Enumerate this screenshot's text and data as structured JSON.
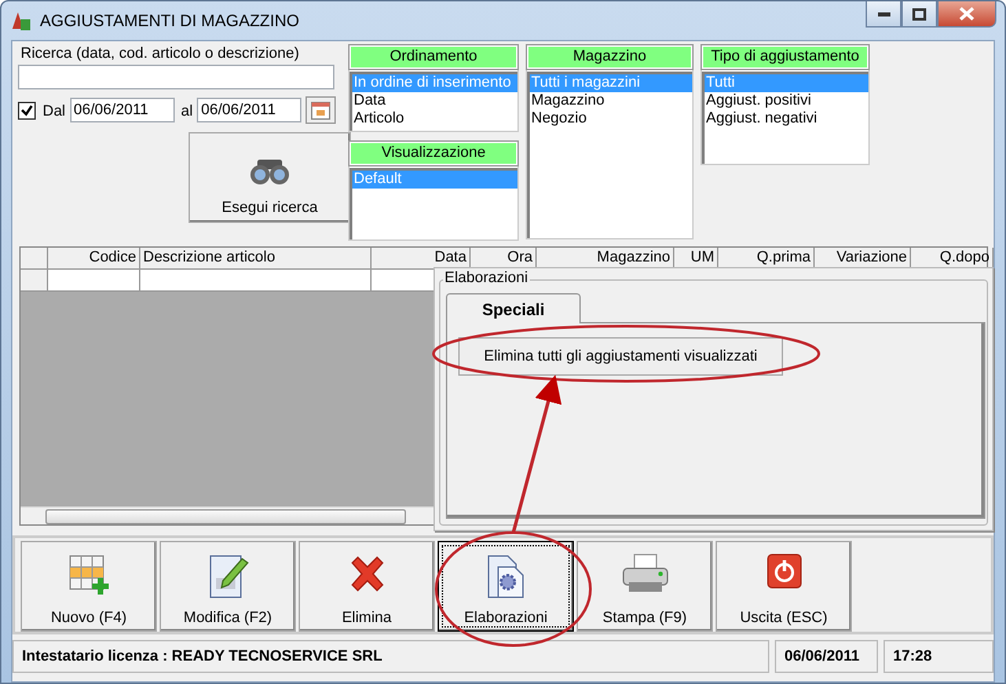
{
  "window": {
    "title": "AGGIUSTAMENTI DI MAGAZZINO"
  },
  "search": {
    "label": "Ricerca (data, cod. articolo o descrizione)"
  },
  "date_filter": {
    "checked": true,
    "from_label": "Dal",
    "from": "06/06/2011",
    "to_label": "al",
    "to": "06/06/2011"
  },
  "search_button": "Esegui ricerca",
  "ordering": {
    "title": "Ordinamento",
    "items": [
      {
        "label": "In ordine di inserimento",
        "selected": true
      },
      {
        "label": "Data",
        "selected": false
      },
      {
        "label": "Articolo",
        "selected": false
      }
    ]
  },
  "view": {
    "title": "Visualizzazione",
    "items": [
      {
        "label": "Default",
        "selected": true
      }
    ]
  },
  "warehouse": {
    "title": "Magazzino",
    "items": [
      {
        "label": "Tutti i magazzini",
        "selected": true
      },
      {
        "label": "Magazzino",
        "selected": false
      },
      {
        "label": "Negozio",
        "selected": false
      }
    ]
  },
  "adjustment_type": {
    "title": "Tipo di aggiustamento",
    "items": [
      {
        "label": "Tutti",
        "selected": true
      },
      {
        "label": "Aggiust. positivi",
        "selected": false
      },
      {
        "label": "Aggiust. negativi",
        "selected": false
      }
    ]
  },
  "table": {
    "columns": [
      "Codice",
      "Descrizione articolo",
      "Data",
      "Ora",
      "Magazzino",
      "UM",
      "Q.prima",
      "Variazione",
      "Q.dopo"
    ]
  },
  "panel": {
    "title": "Elaborazioni",
    "tabs": [
      {
        "label": "Speciali",
        "selected": true
      }
    ],
    "buttons": [
      "Elimina tutti gli aggiustamenti visualizzati"
    ]
  },
  "toolbar": [
    {
      "label": "Nuovo (F4)",
      "kind": "new",
      "focused": false
    },
    {
      "label": "Modifica (F2)",
      "kind": "edit",
      "focused": false
    },
    {
      "label": "Elimina",
      "kind": "delete",
      "focused": false
    },
    {
      "label": "Elaborazioni",
      "kind": "process",
      "focused": true
    },
    {
      "label": "Stampa (F9)",
      "kind": "print",
      "focused": false
    },
    {
      "label": "Uscita (ESC)",
      "kind": "exit",
      "focused": false
    }
  ],
  "status_bar": {
    "license": "Intestatario licenza : READY TECNOSERVICE SRL",
    "date": "06/06/2011",
    "time": "17:28"
  }
}
